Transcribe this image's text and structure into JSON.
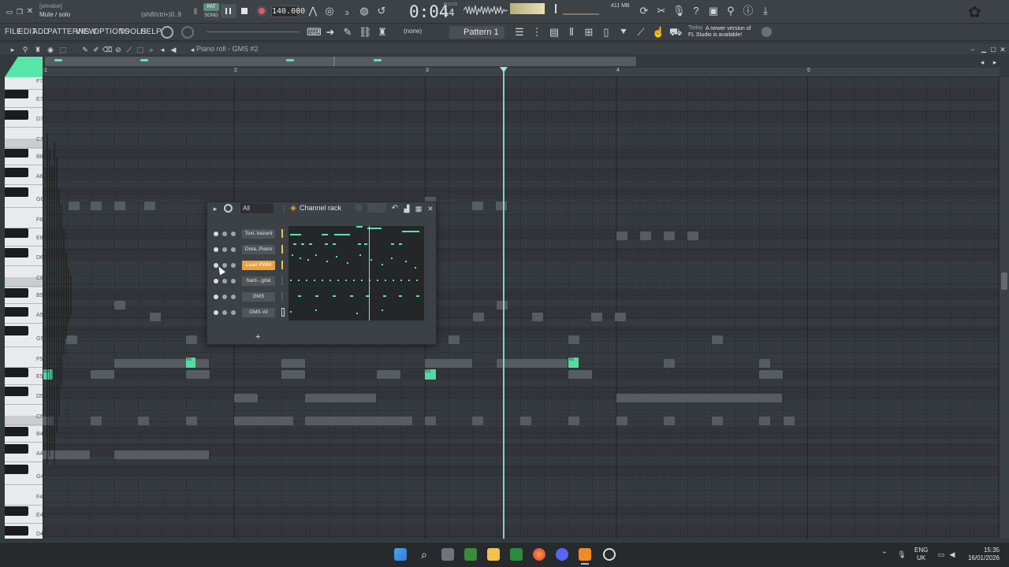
{
  "titlebar": {
    "user": "[johndoe]",
    "hint_text": "Mute / solo",
    "hint_shortcut": "(shift/ctrl+)0..9"
  },
  "transport": {
    "pat_label": "PAT",
    "song_label": "SONG",
    "tempo": "140.000",
    "time_main": "0:04",
    "time_ms": "14",
    "time_sub": "M:S:CS",
    "memory": "411 MB"
  },
  "menu": [
    "FILE",
    "EDIT",
    "ADD",
    "PATTERNS",
    "VIEW",
    "OPTIONS",
    "TOOLS",
    "HELP"
  ],
  "toolbar2": {
    "snap_none": "(none)",
    "pattern": "Pattern 1",
    "news_today": "Today",
    "news_line1": "A newer version of",
    "news_line2": "FL Studio is available!"
  },
  "piano_roll": {
    "title": "Piano roll - GMS #2",
    "bars": [
      "1",
      "2",
      "3",
      "4",
      "5"
    ],
    "notes": [
      "F7",
      "E7",
      "D7",
      "C7",
      "B6",
      "A6",
      "G6",
      "F6",
      "E6",
      "D6",
      "C6",
      "B5",
      "A5",
      "G5",
      "F5",
      "E5",
      "D5",
      "C5",
      "B4",
      "A4",
      "G4",
      "F4",
      "E4",
      "D4"
    ],
    "green_notes": [
      {
        "label": "E5",
        "bar_pos": 0.0
      },
      {
        "label": "F5",
        "bar_pos": 0.75
      },
      {
        "label": "E5",
        "bar_pos": 2.0
      },
      {
        "label": "F5",
        "bar_pos": 2.75
      }
    ]
  },
  "channel_rack": {
    "title": "Channel rack",
    "filter": "All",
    "channels": [
      {
        "name": "Toxi..hazard",
        "selected": false
      },
      {
        "name": "Drea..Piano",
        "selected": false
      },
      {
        "name": "Lead PWM",
        "selected": true
      },
      {
        "name": "hard-..gital",
        "selected": false
      },
      {
        "name": "GMS",
        "selected": false
      },
      {
        "name": "GMS #2",
        "selected": false
      }
    ],
    "add_label": "+"
  },
  "taskbar": {
    "lang_top": "ENG",
    "lang_bottom": "UK",
    "time": "15:35",
    "date": "16/01/2026"
  },
  "colors": {
    "accent": "#58d8a2",
    "selected_channel": "#e9a23d",
    "background": "#34393d"
  }
}
